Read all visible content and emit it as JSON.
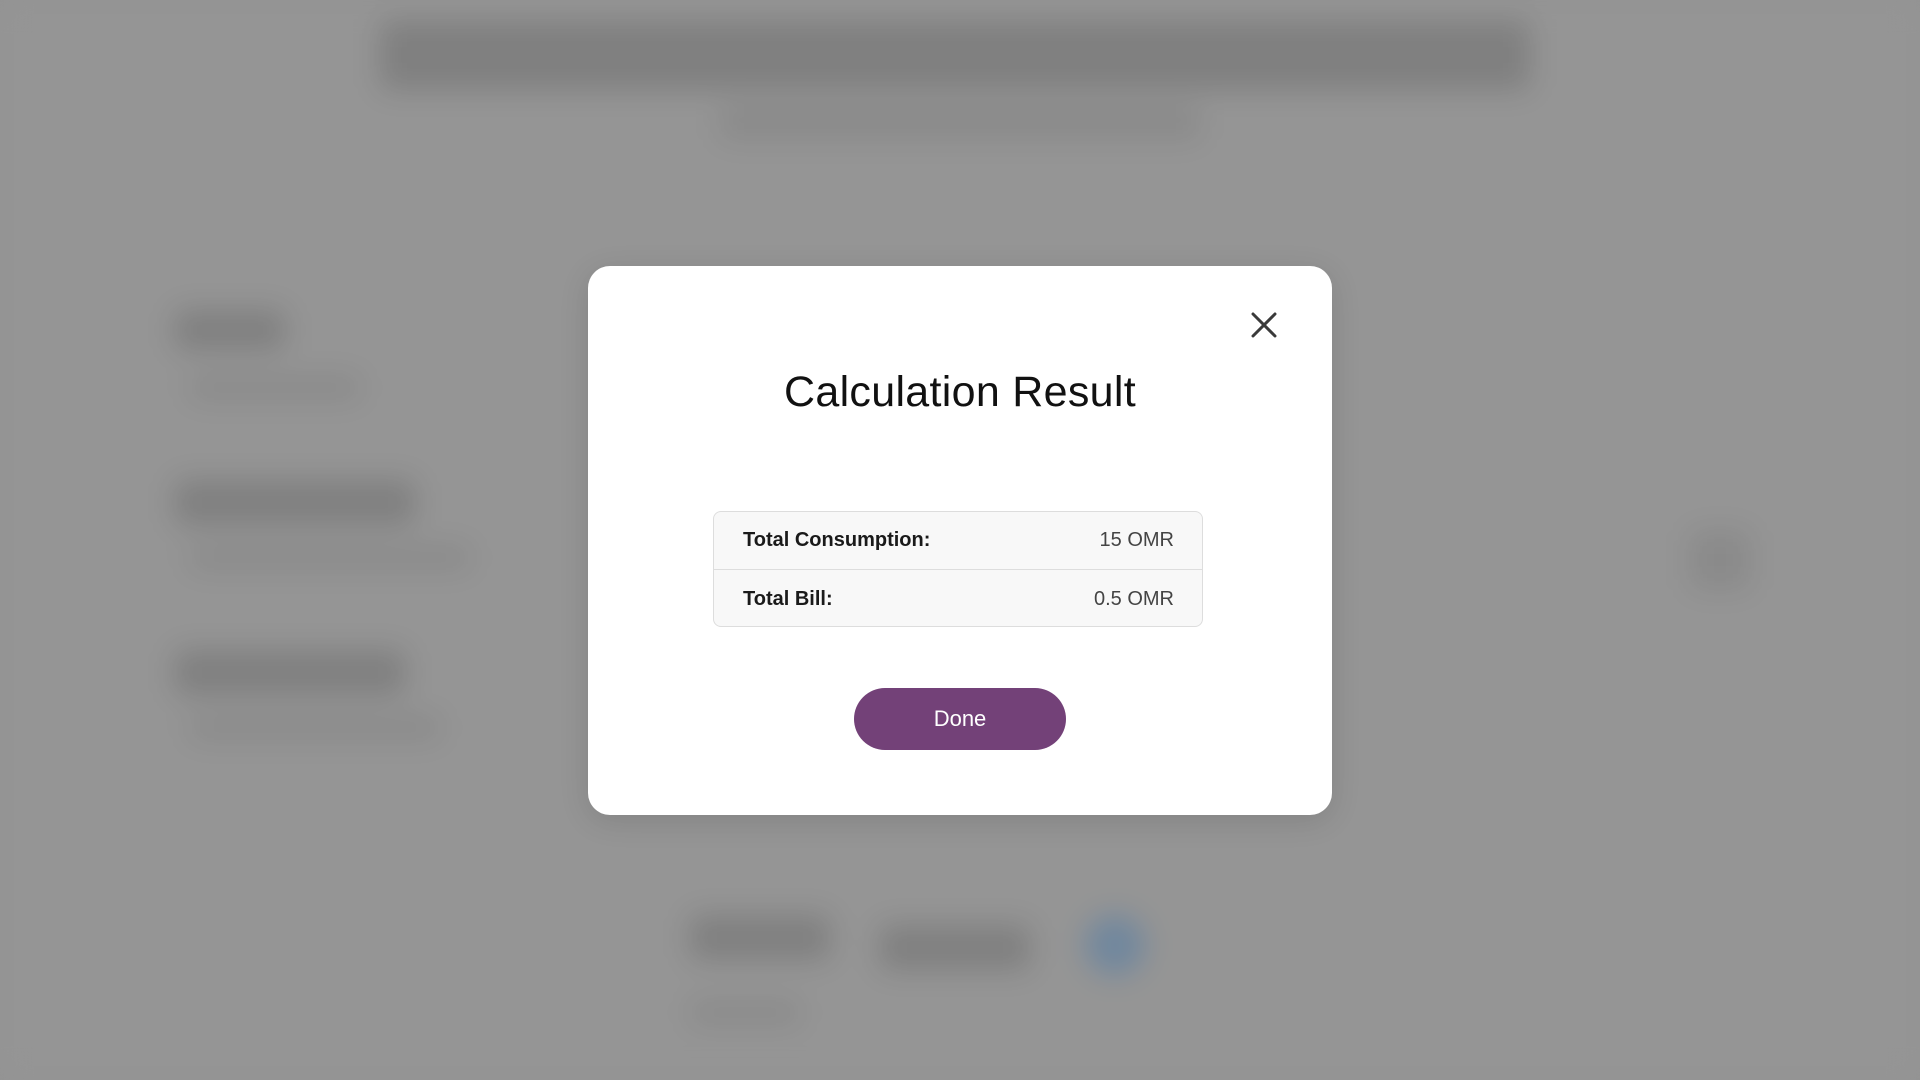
{
  "modal": {
    "title": "Calculation Result",
    "rows": [
      {
        "label": "Total Consumption:",
        "value": "15 OMR"
      },
      {
        "label": "Total Bill:",
        "value": "0.5 OMR"
      }
    ],
    "done_label": "Done",
    "close_icon": "close-icon"
  },
  "colors": {
    "accent": "#734178",
    "backdrop": "#9a9a9a",
    "modal_bg": "#ffffff"
  }
}
